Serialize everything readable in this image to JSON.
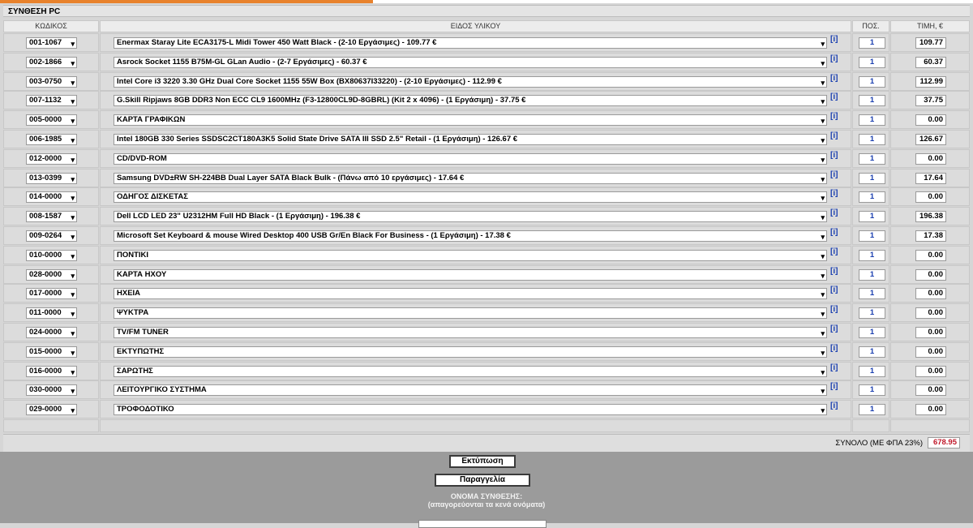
{
  "panel": {
    "title": "ΣΥΝΘΕΣΗ PC"
  },
  "headers": {
    "code": "ΚΩΔΙΚΟΣ",
    "description": "ΕΙΔΟΣ ΥΛΙΚΟΥ",
    "qty": "ΠΟΣ.",
    "price": "ΤΙΜΗ, €"
  },
  "info_label": "[i]",
  "rows": [
    {
      "code": "001-1067",
      "description": "Enermax Staray Lite ECA3175-L Midi Tower 450 Watt Black - (2-10 Εργάσιμες) - 109.77 €",
      "qty": "1",
      "price": "109.77"
    },
    {
      "code": "002-1866",
      "description": "Asrock Socket 1155 B75M-GL GLan Audio - (2-7 Εργάσιμες) - 60.37 €",
      "qty": "1",
      "price": "60.37"
    },
    {
      "code": "003-0750",
      "description": "Intel Core i3 3220 3.30 GHz Dual Core Socket 1155 55W Box (BX80637I33220) - (2-10 Εργάσιμες) - 112.99 €",
      "qty": "1",
      "price": "112.99"
    },
    {
      "code": "007-1132",
      "description": "G.Skill Ripjaws 8GB DDR3 Non ECC CL9 1600MHz (F3-12800CL9D-8GBRL) (Kit 2 x 4096) - (1 Εργάσιμη) - 37.75 €",
      "qty": "1",
      "price": "37.75"
    },
    {
      "code": "005-0000",
      "description": "ΚΑΡΤΑ ΓΡΑΦΙΚΩΝ",
      "qty": "1",
      "price": "0.00"
    },
    {
      "code": "006-1985",
      "description": "Intel 180GB 330 Series SSDSC2CT180A3K5 Solid State Drive SATA III SSD 2.5\" Retail - (1 Εργάσιμη) - 126.67 €",
      "qty": "1",
      "price": "126.67"
    },
    {
      "code": "012-0000",
      "description": "CD/DVD-ROM",
      "qty": "1",
      "price": "0.00"
    },
    {
      "code": "013-0399",
      "description": "Samsung DVD±RW SH-224BB Dual Layer SATA Black Bulk - (Πάνω από 10 εργάσιμες) - 17.64 €",
      "qty": "1",
      "price": "17.64"
    },
    {
      "code": "014-0000",
      "description": "ΟΔΗΓΟΣ ΔΙΣΚΕΤΑΣ",
      "qty": "1",
      "price": "0.00"
    },
    {
      "code": "008-1587",
      "description": "Dell LCD LED 23\" U2312HM Full HD Black - (1 Εργάσιμη) - 196.38 €",
      "qty": "1",
      "price": "196.38"
    },
    {
      "code": "009-0264",
      "description": "Microsoft Set Keyboard & mouse Wired Desktop 400 USB Gr/En Black For Business - (1 Εργάσιμη) - 17.38 €",
      "qty": "1",
      "price": "17.38"
    },
    {
      "code": "010-0000",
      "description": "ΠΟΝΤΙΚΙ",
      "qty": "1",
      "price": "0.00"
    },
    {
      "code": "028-0000",
      "description": "ΚΑΡΤΑ ΗΧΟΥ",
      "qty": "1",
      "price": "0.00"
    },
    {
      "code": "017-0000",
      "description": "ΗΧΕΙΑ",
      "qty": "1",
      "price": "0.00"
    },
    {
      "code": "011-0000",
      "description": "ΨΥΚΤΡΑ",
      "qty": "1",
      "price": "0.00"
    },
    {
      "code": "024-0000",
      "description": "TV/FM TUNER",
      "qty": "1",
      "price": "0.00"
    },
    {
      "code": "015-0000",
      "description": "ΕΚΤΥΠΩΤΗΣ",
      "qty": "1",
      "price": "0.00"
    },
    {
      "code": "016-0000",
      "description": "ΣΑΡΩΤΗΣ",
      "qty": "1",
      "price": "0.00"
    },
    {
      "code": "030-0000",
      "description": "ΛΕΙΤΟΥΡΓΙΚΟ ΣΥΣΤΗΜΑ",
      "qty": "1",
      "price": "0.00"
    },
    {
      "code": "029-0000",
      "description": "ΤΡΟΦΟΔΟΤΙΚΟ",
      "qty": "1",
      "price": "0.00"
    }
  ],
  "total": {
    "label": "ΣΥΝΟΛΟ (ΜΕ ΦΠΑ 23%)",
    "value": "678.95"
  },
  "buttons": {
    "print": "Εκτύπωση",
    "order": "Παραγγελία"
  },
  "name_section": {
    "label": "ΟΝΟΜΑ ΣΥΝΘΕΣΗΣ:",
    "note": "(απαγορεύονται τα κενά ονόματα)"
  },
  "colors": {
    "accent_orange": "#e8822c",
    "info_blue": "#1a3fb0",
    "total_red": "#c0182a"
  },
  "icons": {
    "dropdown": "chevron-down-icon",
    "info": "info-icon"
  }
}
